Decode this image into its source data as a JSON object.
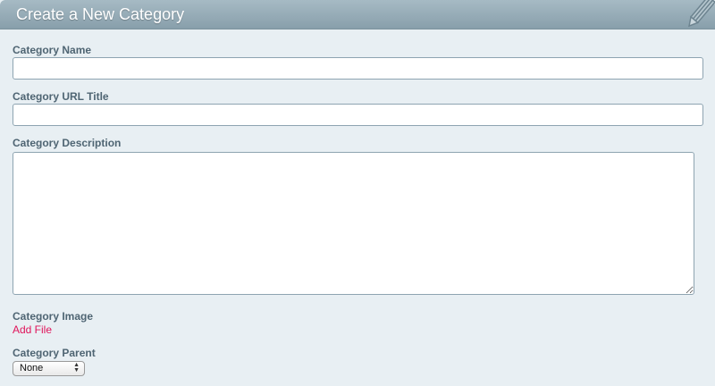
{
  "header": {
    "title": "Create a New Category",
    "icon": "pencil-icon"
  },
  "form": {
    "name": {
      "label": "Category Name",
      "value": ""
    },
    "url_title": {
      "label": "Category URL Title",
      "value": ""
    },
    "description": {
      "label": "Category Description",
      "value": ""
    },
    "image": {
      "label": "Category Image",
      "link_label": "Add File"
    },
    "parent": {
      "label": "Category Parent",
      "selected": "None"
    }
  },
  "colors": {
    "header_bg": "#98adb8",
    "page_bg": "#e8eff3",
    "label_text": "#4f6573",
    "link": "#e0135a"
  }
}
